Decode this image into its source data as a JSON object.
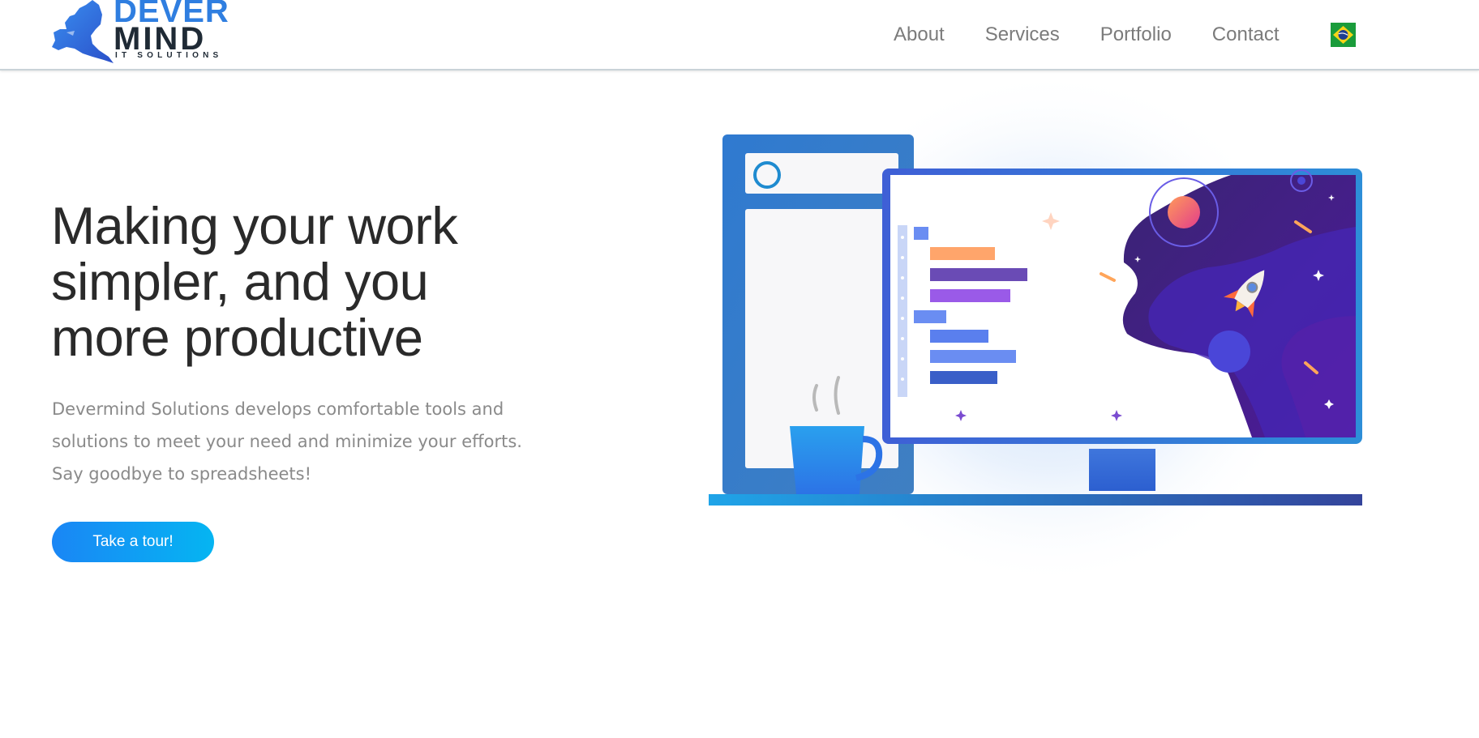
{
  "brand": {
    "word1": "DEVER",
    "word2": "MIND",
    "tagline": "IT SOLUTIONS",
    "primary_color": "#2f7ee0",
    "dark_color": "#1f2a35"
  },
  "nav": {
    "items": [
      {
        "label": "About"
      },
      {
        "label": "Services"
      },
      {
        "label": "Portfolio"
      },
      {
        "label": "Contact"
      }
    ],
    "language_icon": "brazil-flag-icon"
  },
  "hero": {
    "title_line1": "Making your work",
    "title_line2": "simpler, and you",
    "title_line3": "more productive",
    "desc_line1": "Devermind Solutions develops comfortable tools and",
    "desc_line2": "solutions to meet your need and minimize your efforts.",
    "desc_line3": "Say goodbye to spreadsheets!",
    "cta_label": "Take a tour!",
    "cta_colors": [
      "#1a86f5",
      "#05b5f2"
    ]
  },
  "illustration": {
    "icon": "workspace-illustration"
  }
}
